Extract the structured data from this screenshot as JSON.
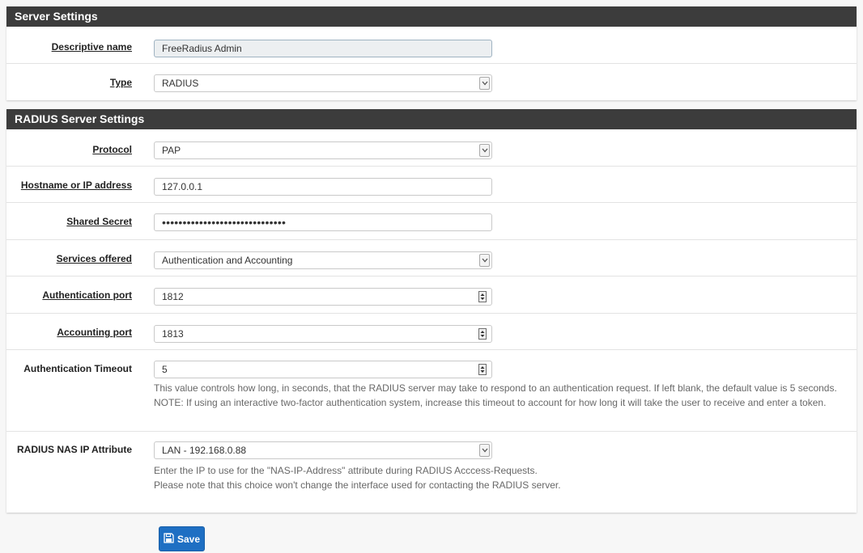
{
  "server_settings": {
    "title": "Server Settings",
    "descriptive_name": {
      "label": "Descriptive name",
      "value": "FreeRadius Admin"
    },
    "type": {
      "label": "Type",
      "value": "RADIUS"
    }
  },
  "radius_settings": {
    "title": "RADIUS Server Settings",
    "protocol": {
      "label": "Protocol",
      "value": "PAP"
    },
    "hostname": {
      "label": "Hostname or IP address",
      "value": "127.0.0.1"
    },
    "shared_secret": {
      "label": "Shared Secret",
      "value": "••••••••••••••••••••••••••••••"
    },
    "services": {
      "label": "Services offered",
      "value": "Authentication and Accounting"
    },
    "auth_port": {
      "label": "Authentication port",
      "value": "1812"
    },
    "acct_port": {
      "label": "Accounting port",
      "value": "1813"
    },
    "auth_timeout": {
      "label": "Authentication Timeout",
      "value": "5",
      "help": "This value controls how long, in seconds, that the RADIUS server may take to respond to an authentication request. If left blank, the default value is 5 seconds. NOTE: If using an interactive two-factor authentication system, increase this timeout to account for how long it will take the user to receive and enter a token."
    },
    "nas_ip": {
      "label": "RADIUS NAS IP Attribute",
      "value": "LAN - 192.168.0.88",
      "help_line1": "Enter the IP to use for the \"NAS-IP-Address\" attribute during RADIUS Acccess-Requests.",
      "help_line2": "Please note that this choice won't change the interface used for contacting the RADIUS server."
    }
  },
  "save_button": {
    "label": "Save",
    "icon": "save-icon",
    "color": "#1e6fc3"
  }
}
